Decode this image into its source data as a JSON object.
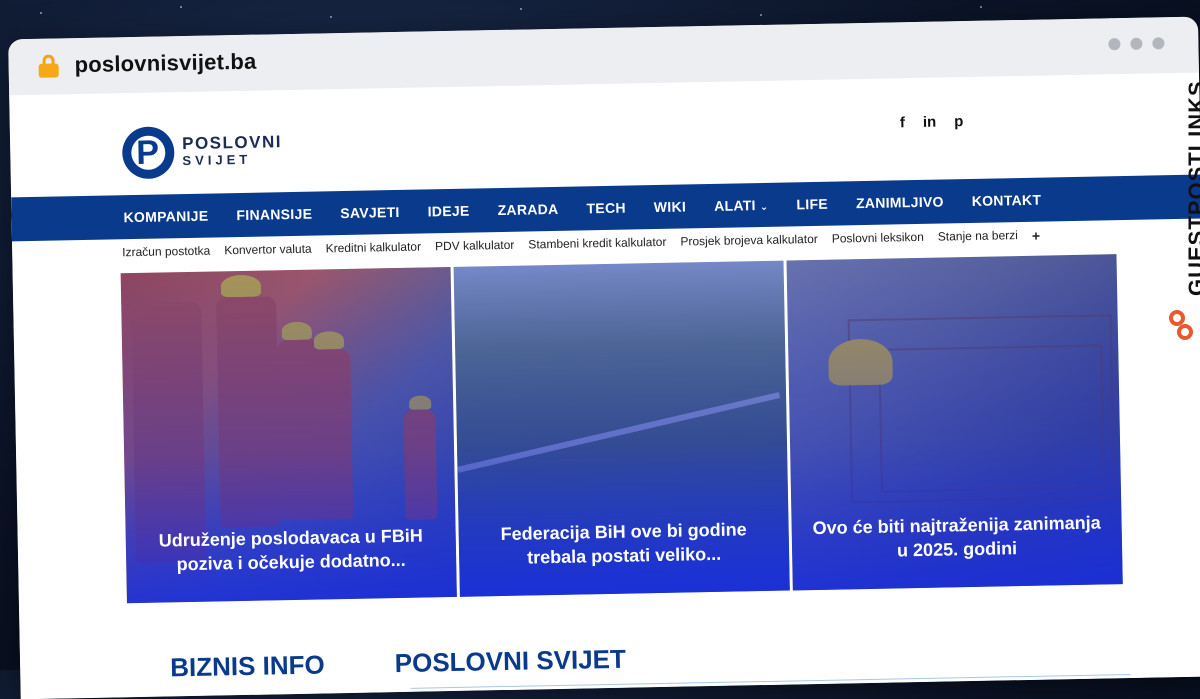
{
  "browser": {
    "url": "poslovnisvijet.ba"
  },
  "site": {
    "logo_line1": "POSLOVNI",
    "logo_line2": "SVIJET",
    "social": [
      "f",
      "in",
      "p"
    ]
  },
  "mainnav": {
    "items": [
      "KOMPANIJE",
      "FINANSIJE",
      "SAVJETI",
      "IDEJE",
      "ZARADA",
      "TECH",
      "WIKI",
      "ALATI",
      "LIFE",
      "ZANIMLJIVO",
      "KONTAKT"
    ],
    "caret": "⌄"
  },
  "subnav": {
    "items": [
      "Izračun postotka",
      "Konvertor valuta",
      "Kreditni kalkulator",
      "PDV kalkulator",
      "Stambeni kredit kalkulator",
      "Prosjek brojeva kalkulator",
      "Poslovni leksikon",
      "Stanje na berzi",
      "+"
    ]
  },
  "heroes": [
    {
      "caption": "Udruženje poslodavaca u FBiH poziva i očekuje dodatno..."
    },
    {
      "caption": "Federacija BiH ove bi godine trebala postati veliko..."
    },
    {
      "caption": "Ovo će biti najtraženija zanimanja u 2025. godini"
    }
  ],
  "sections": {
    "left": "BIZNIS INFO",
    "right": "POSLOVNI SVIJET"
  },
  "badge": {
    "text": "GUESTPOSTLINKS"
  },
  "colors": {
    "brand": "#0a3a8c",
    "accent": "#e8592d"
  }
}
